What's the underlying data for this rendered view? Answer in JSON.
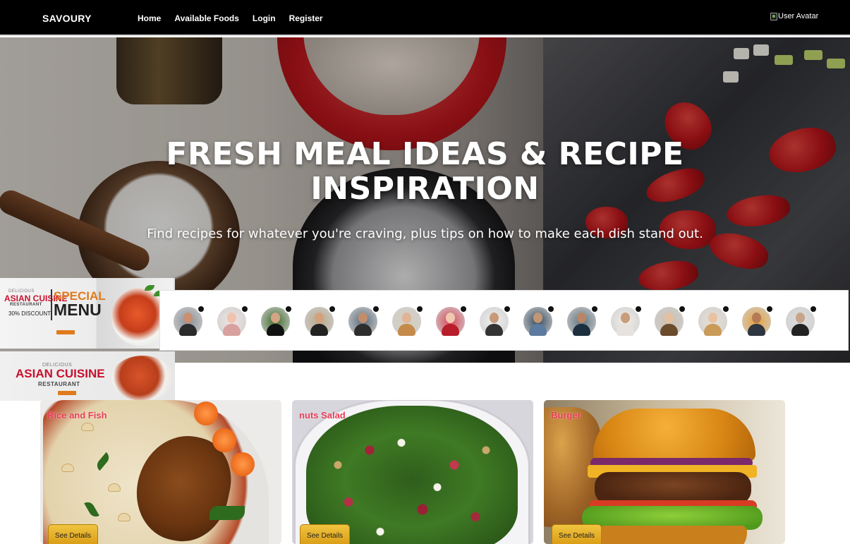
{
  "navbar": {
    "brand": "SAVOURY",
    "links": [
      "Home",
      "Available Foods",
      "Login",
      "Register"
    ],
    "avatar_alt": "User Avatar"
  },
  "hero": {
    "title": "FRESH MEAL IDEAS & RECIPE INSPIRATION",
    "subtitle": "Find recipes for whatever you're craving, plus tips on how to make each dish stand out."
  },
  "banners": {
    "banner1": {
      "kicker": "DELICIOUS",
      "title": "ASIAN CUISINE",
      "subtitle": "RESTAURANT",
      "special": "SPECIAL",
      "menu": "MENU",
      "discount": "30% DISCOUNT"
    },
    "banner2": {
      "kicker": "DELICIOUS",
      "title": "ASIAN CUISINE",
      "subtitle": "RESTAURANT"
    }
  },
  "profiles_count": 15,
  "foods": [
    {
      "name": "Rice and Fish",
      "button": "See Details"
    },
    {
      "name": "nuts Salad",
      "button": "See Details"
    },
    {
      "name": "Burger",
      "button": "See Details"
    }
  ],
  "colors": {
    "navbar_bg": "#000000",
    "card_title": "#e83e57",
    "button_gold": "#e3ad24"
  }
}
